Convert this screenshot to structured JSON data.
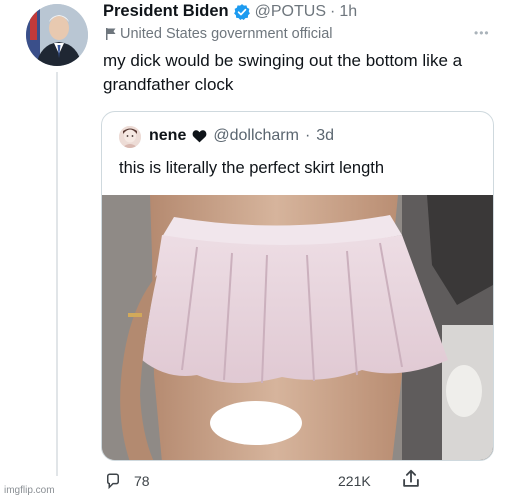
{
  "post": {
    "author_name": "President Biden",
    "author_handle": "@POTUS",
    "separator": "·",
    "time_ago": "1h",
    "account_label": "United States government official",
    "text": "my dick would be swinging out the bottom like a grandfather clock",
    "avatar_icon": "profile-photo",
    "verified_icon": "verified-badge-icon",
    "verified_color": "#1d9bf0"
  },
  "quoted_post": {
    "author_name": "nene",
    "author_handle": "@dollcharm",
    "separator": "·",
    "time_ago": "3d",
    "text": "this is literally the perfect skirt length",
    "heart_icon": "heart-icon"
  },
  "actions": {
    "reply_count": "78",
    "like_count": "221K",
    "reply_icon": "reply-icon",
    "share_icon": "share-icon"
  },
  "watermark": "imgflip.com"
}
